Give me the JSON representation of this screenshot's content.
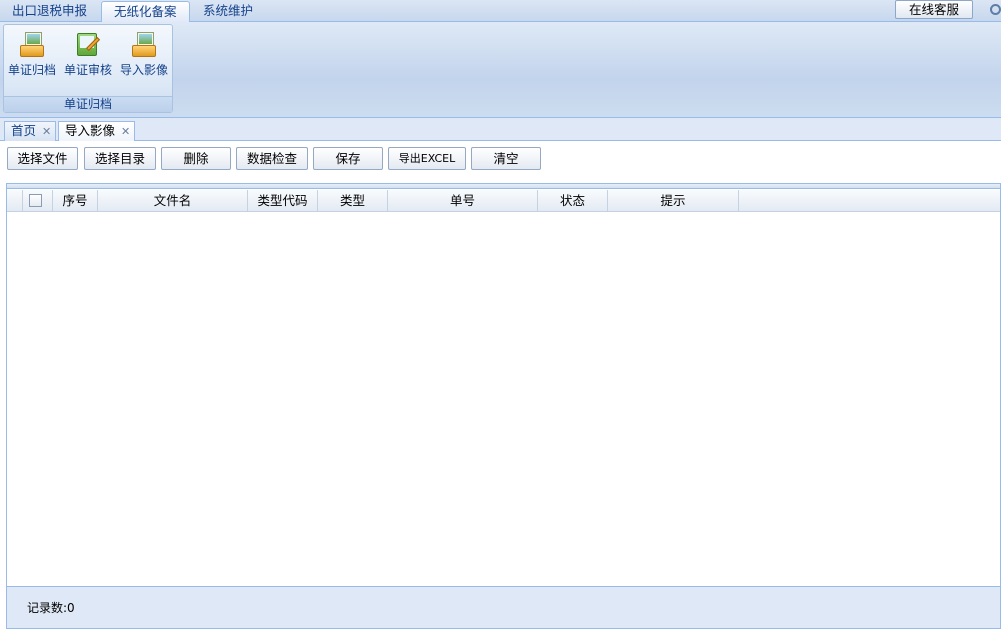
{
  "menu": {
    "tabs": [
      {
        "label": "出口退税申报"
      },
      {
        "label": "无纸化备案"
      },
      {
        "label": "系统维护"
      }
    ],
    "service_label": "在线客服"
  },
  "ribbon": {
    "group_label": "单证归档",
    "buttons": [
      {
        "label": "单证归档",
        "icon": "archive-icon"
      },
      {
        "label": "单证审核",
        "icon": "review-icon"
      },
      {
        "label": "导入影像",
        "icon": "import-image-icon"
      }
    ]
  },
  "doc_tabs": [
    {
      "label": "首页"
    },
    {
      "label": "导入影像"
    }
  ],
  "toolbar": {
    "select_file": "选择文件",
    "select_dir": "选择目录",
    "delete": "删除",
    "check": "数据检查",
    "save": "保存",
    "export": "导出EXCEL",
    "clear": "清空"
  },
  "grid": {
    "columns": [
      "序号",
      "文件名",
      "类型代码",
      "类型",
      "单号",
      "状态",
      "提示"
    ],
    "rows": [],
    "record_count": "记录数:0"
  }
}
